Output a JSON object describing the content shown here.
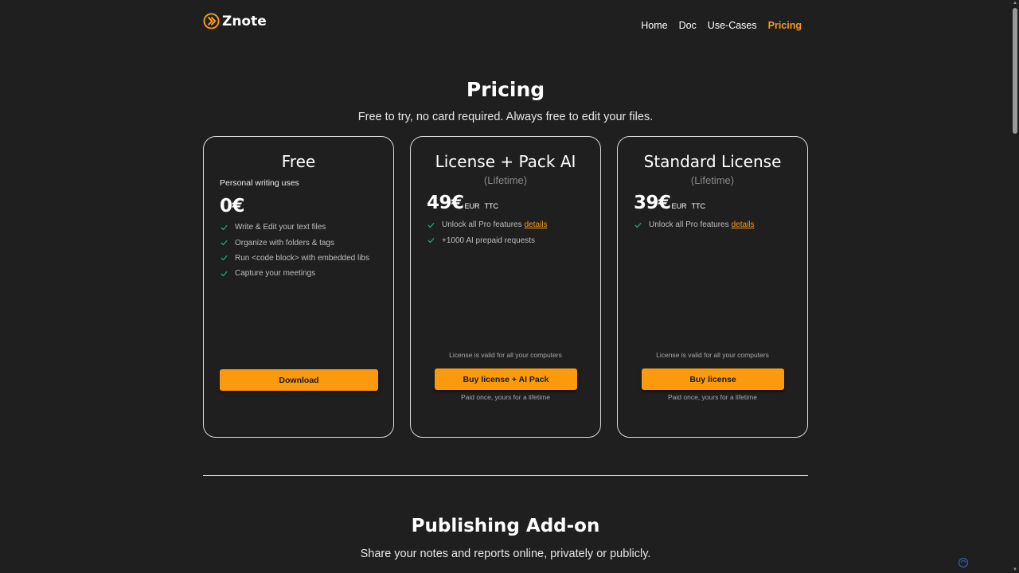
{
  "brand": {
    "name": "Znote",
    "accent": "#f59a1c"
  },
  "nav": {
    "items": [
      {
        "label": "Home",
        "active": false
      },
      {
        "label": "Doc",
        "active": false
      },
      {
        "label": "Use-Cases",
        "active": false
      },
      {
        "label": "Pricing",
        "active": true
      }
    ]
  },
  "pricing": {
    "title": "Pricing",
    "subtitle": "Free to try, no card required. Always free to edit your files."
  },
  "plans": {
    "free": {
      "title": "Free",
      "description": "Personal writing uses",
      "price": "0€",
      "features": [
        "Write & Edit your text files",
        "Organize with folders & tags",
        "Run <code block> with embedded libs",
        "Capture your meetings"
      ],
      "button": "Download"
    },
    "ai": {
      "title": "License + Pack AI",
      "term": "(Lifetime)",
      "price": "49€",
      "currency": "EUR",
      "tax": "TTC",
      "feature1": "Unlock all Pro features",
      "feature1_link": "details",
      "feature2": "+1000 AI prepaid requests",
      "validity": "License is valid for all your computers",
      "button": "Buy license + AI Pack",
      "note": "Paid once, yours for a lifetime"
    },
    "standard": {
      "title": "Standard License",
      "term": "(Lifetime)",
      "price": "39€",
      "currency": "EUR",
      "tax": "TTC",
      "feature1": "Unlock all Pro features",
      "feature1_link": "details",
      "validity": "License is valid for all your computers",
      "button": "Buy license",
      "note": "Paid once, yours for a lifetime"
    }
  },
  "addon": {
    "title": "Publishing Add-on",
    "subtitle": "Share your notes and reports online, privately or publicly."
  }
}
